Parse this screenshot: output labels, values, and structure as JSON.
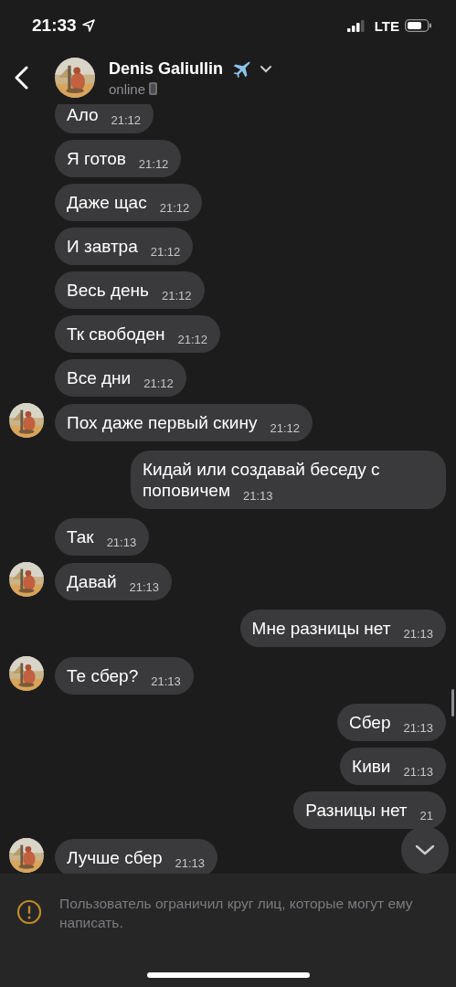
{
  "status_bar": {
    "time": "21:33",
    "network": "LTE"
  },
  "header": {
    "name": "Denis Galiullin",
    "status": "online"
  },
  "messages": [
    {
      "kind": "incoming",
      "text": "Ало",
      "time": "21:12"
    },
    {
      "kind": "incoming",
      "text": "Я готов",
      "time": "21:12"
    },
    {
      "kind": "incoming",
      "text": "Даже щас",
      "time": "21:12"
    },
    {
      "kind": "incoming",
      "text": "И завтра",
      "time": "21:12"
    },
    {
      "kind": "incoming",
      "text": "Весь день",
      "time": "21:12"
    },
    {
      "kind": "incoming",
      "text": "Тк свободен",
      "time": "21:12"
    },
    {
      "kind": "incoming",
      "text": "Все дни",
      "time": "21:12"
    },
    {
      "kind": "incoming",
      "text": "Пох даже первый скину",
      "time": "21:12"
    },
    {
      "kind": "outgoing",
      "text": "Кидай или создавай беседу с поповичем",
      "time": "21:13"
    },
    {
      "kind": "incoming",
      "text": "Так",
      "time": "21:13"
    },
    {
      "kind": "incoming",
      "text": "Давай",
      "time": "21:13"
    },
    {
      "kind": "outgoing",
      "text": "Мне разницы нет",
      "time": "21:13"
    },
    {
      "kind": "incoming",
      "text": "Те сбер?",
      "time": "21:13"
    },
    {
      "kind": "outgoing",
      "text": "Сбер",
      "time": "21:13"
    },
    {
      "kind": "outgoing",
      "text": "Киви",
      "time": "21:13"
    },
    {
      "kind": "outgoing",
      "text": "Разницы нет",
      "time": "21"
    },
    {
      "kind": "incoming",
      "text": "Лучше сбер",
      "time": "21:13"
    }
  ],
  "notice": {
    "text": "Пользователь ограничил круг лиц, которые могут ему написать."
  }
}
